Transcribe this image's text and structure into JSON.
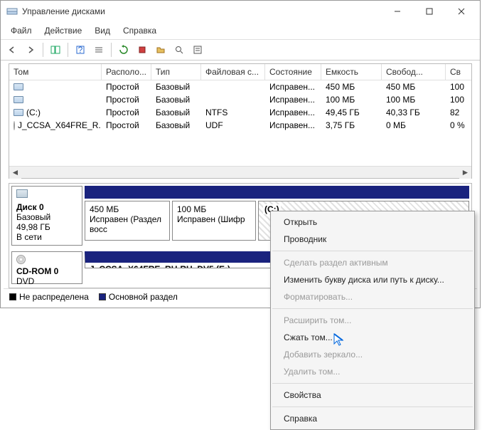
{
  "window": {
    "title": "Управление дисками"
  },
  "menu": {
    "file": "Файл",
    "action": "Действие",
    "view": "Вид",
    "help": "Справка"
  },
  "columns": [
    "Том",
    "Располо...",
    "Тип",
    "Файловая с...",
    "Состояние",
    "Емкость",
    "Свобод...",
    "Св"
  ],
  "volumes": [
    {
      "name": "",
      "layout": "Простой",
      "type": "Базовый",
      "fs": "",
      "status": "Исправен...",
      "capacity": "450 МБ",
      "free": "450 МБ",
      "pct": "100"
    },
    {
      "name": "",
      "layout": "Простой",
      "type": "Базовый",
      "fs": "",
      "status": "Исправен...",
      "capacity": "100 МБ",
      "free": "100 МБ",
      "pct": "100"
    },
    {
      "name": "(C:)",
      "layout": "Простой",
      "type": "Базовый",
      "fs": "NTFS",
      "status": "Исправен...",
      "capacity": "49,45 ГБ",
      "free": "40,33 ГБ",
      "pct": "82"
    },
    {
      "name": "J_CCSA_X64FRE_R...",
      "layout": "Простой",
      "type": "Базовый",
      "fs": "UDF",
      "status": "Исправен...",
      "capacity": "3,75 ГБ",
      "free": "0 МБ",
      "pct": "0 %"
    }
  ],
  "disk0": {
    "label": "Диск 0",
    "kind": "Базовый",
    "size": "49,98 ГБ",
    "state": "В сети",
    "parts": [
      {
        "size": "450 МБ",
        "status": "Исправен (Раздел восс"
      },
      {
        "size": "100 МБ",
        "status": "Исправен (Шифр"
      },
      {
        "label": "(C:)",
        "selected": true
      }
    ]
  },
  "cdrom": {
    "label": "CD-ROM 0",
    "kind": "DVD",
    "vol": "J_CCSA_X64FRE_RU-RU_DV5 (E:)"
  },
  "legend": {
    "unalloc": "Не распределена",
    "primary": "Основной раздел"
  },
  "context": {
    "open": "Открыть",
    "explorer": "Проводник",
    "make_active": "Сделать раздел активным",
    "change_letter": "Изменить букву диска или путь к диску...",
    "format": "Форматировать...",
    "extend": "Расширить том...",
    "shrink": "Сжать том...",
    "add_mirror": "Добавить зеркало...",
    "delete": "Удалить том...",
    "properties": "Свойства",
    "help": "Справка"
  }
}
